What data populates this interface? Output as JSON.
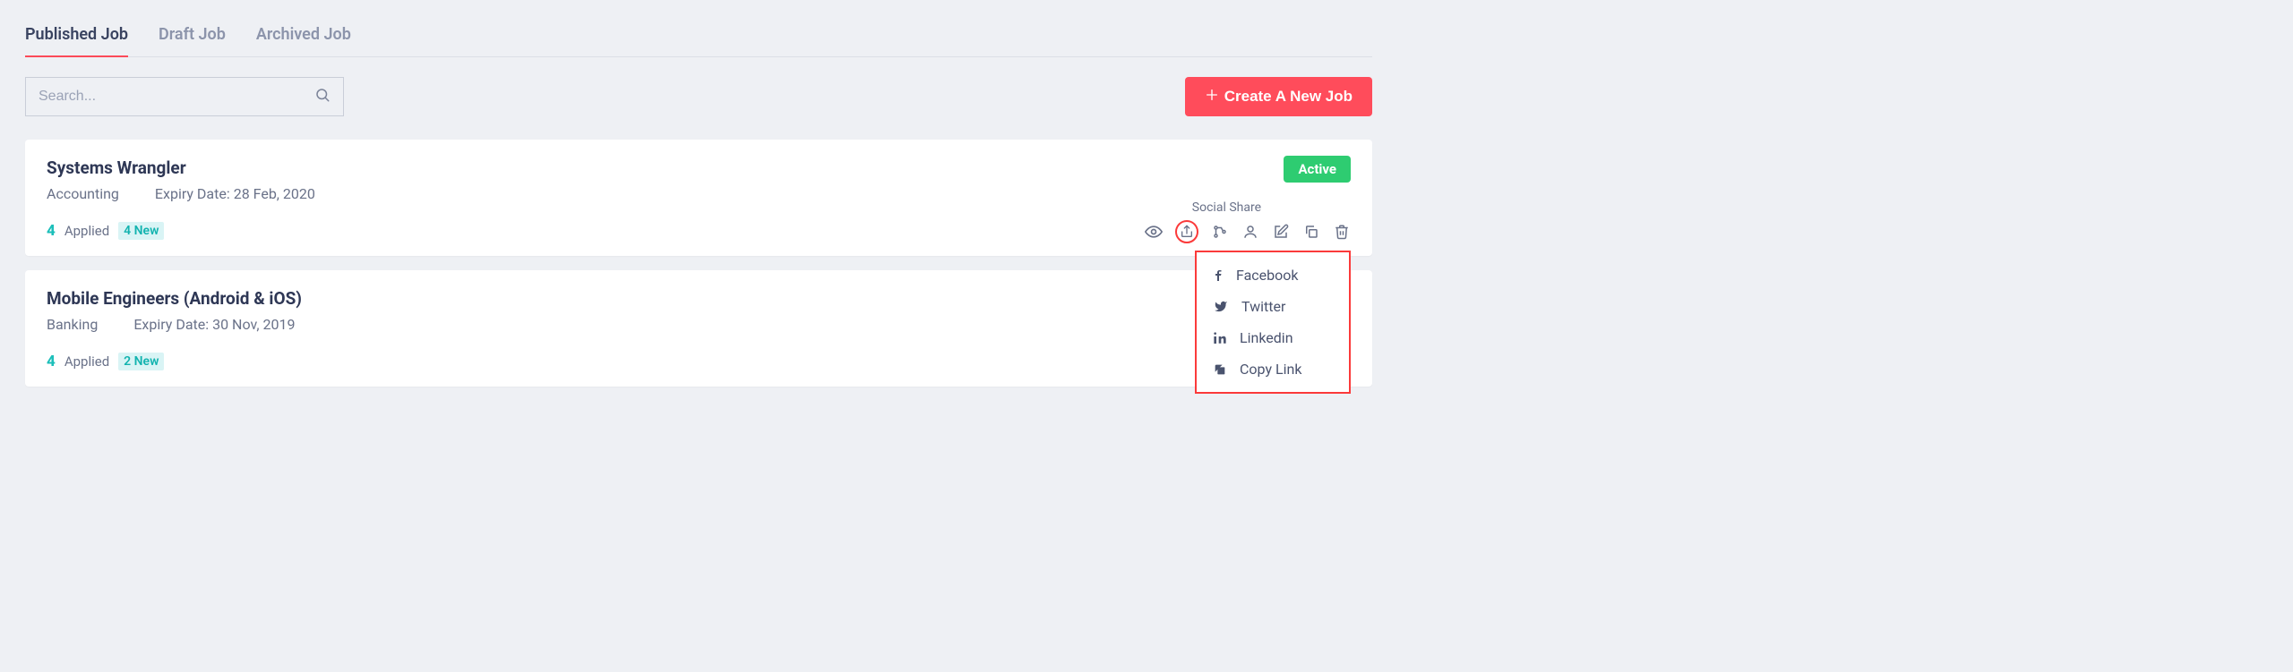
{
  "tabs": {
    "published": "Published Job",
    "draft": "Draft Job",
    "archived": "Archived Job"
  },
  "search": {
    "placeholder": "Search..."
  },
  "create_label": "Create A New Job",
  "social_share_label": "Social Share",
  "share_menu": {
    "facebook": "Facebook",
    "twitter": "Twitter",
    "linkedin": "Linkedin",
    "copy": "Copy Link"
  },
  "jobs": [
    {
      "title": "Systems Wrangler",
      "category": "Accounting",
      "expiry": "Expiry Date: 28 Feb, 2020",
      "applied_count": "4",
      "applied_label": "Applied",
      "new_badge": "4 New",
      "status": "Active"
    },
    {
      "title": "Mobile Engineers (Android & iOS)",
      "category": "Banking",
      "expiry": "Expiry Date: 30 Nov, 2019",
      "applied_count": "4",
      "applied_label": "Applied",
      "new_badge": "2 New",
      "status": ""
    }
  ]
}
